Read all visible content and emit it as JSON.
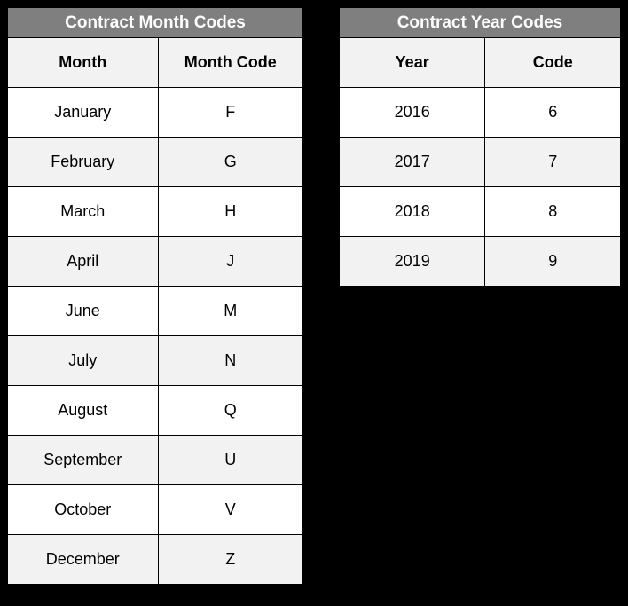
{
  "monthTable": {
    "title": "Contract Month Codes",
    "headers": {
      "c1": "Month",
      "c2": "Month Code"
    },
    "rows": [
      {
        "c1": "January",
        "c2": "F"
      },
      {
        "c1": "February",
        "c2": "G"
      },
      {
        "c1": "March",
        "c2": "H"
      },
      {
        "c1": "April",
        "c2": "J"
      },
      {
        "c1": "June",
        "c2": "M"
      },
      {
        "c1": "July",
        "c2": "N"
      },
      {
        "c1": "August",
        "c2": "Q"
      },
      {
        "c1": "September",
        "c2": "U"
      },
      {
        "c1": "October",
        "c2": "V"
      },
      {
        "c1": "December",
        "c2": "Z"
      }
    ]
  },
  "yearTable": {
    "title": "Contract Year Codes",
    "headers": {
      "c1": "Year",
      "c2": "Code"
    },
    "rows": [
      {
        "c1": "2016",
        "c2": "6"
      },
      {
        "c1": "2017",
        "c2": "7"
      },
      {
        "c1": "2018",
        "c2": "8"
      },
      {
        "c1": "2019",
        "c2": "9"
      }
    ]
  }
}
